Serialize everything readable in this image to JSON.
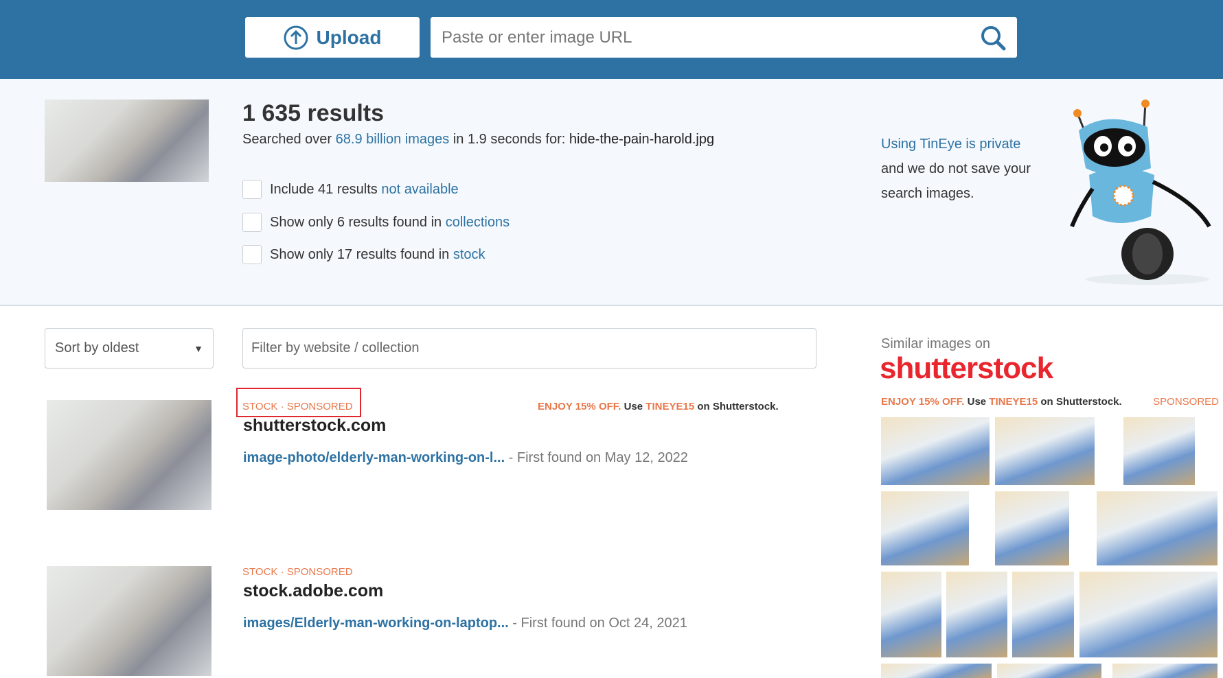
{
  "header": {
    "upload_label": "Upload",
    "url_placeholder": "Paste or enter image URL",
    "icons": {
      "upload": "upload-arrow-circle-icon",
      "search": "search-icon"
    }
  },
  "summary": {
    "count": "1 635 results",
    "searched_prefix": "Searched over ",
    "searched_link": "68.9 billion images",
    "searched_mid": " in 1.9 seconds for: ",
    "filename": "hide-the-pain-harold.jpg"
  },
  "filters": [
    {
      "text": "Include 41 results ",
      "link": "not available",
      "checked": false
    },
    {
      "text": "Show only 6 results found in ",
      "link": "collections",
      "checked": false
    },
    {
      "text": "Show only 17 results found in ",
      "link": "stock",
      "checked": false
    }
  ],
  "privacy": {
    "link": "Using TinEye is private",
    "text": "and we do not save your search images."
  },
  "sort": {
    "value": "Sort by oldest"
  },
  "filter_input": {
    "placeholder": "Filter by website / collection"
  },
  "results": [
    {
      "tag1": "STOCK",
      "sep": "·",
      "tag2": "SPONSORED",
      "domain": "shutterstock.com",
      "link": "image-photo/elderly-man-working-on-l...",
      "found": " - First found on May 12, 2022",
      "promo": true
    },
    {
      "tag1": "STOCK",
      "sep": "·",
      "tag2": "SPONSORED",
      "domain": "stock.adobe.com",
      "link": "images/Elderly-man-working-on-laptop...",
      "found": " - First found on Oct 24, 2021",
      "promo": false
    }
  ],
  "promo": {
    "offer": "ENJOY 15% OFF.",
    "use": " Use ",
    "code": "TINEYE15",
    "suffix": " on Shutterstock."
  },
  "similar": {
    "title": "Similar images on",
    "logo": "shutterstock",
    "sponsored": "SPONSORED"
  },
  "colors": {
    "brand": "#2d72a3",
    "accent": "#e8774a",
    "shutterstock": "#e9262e"
  }
}
